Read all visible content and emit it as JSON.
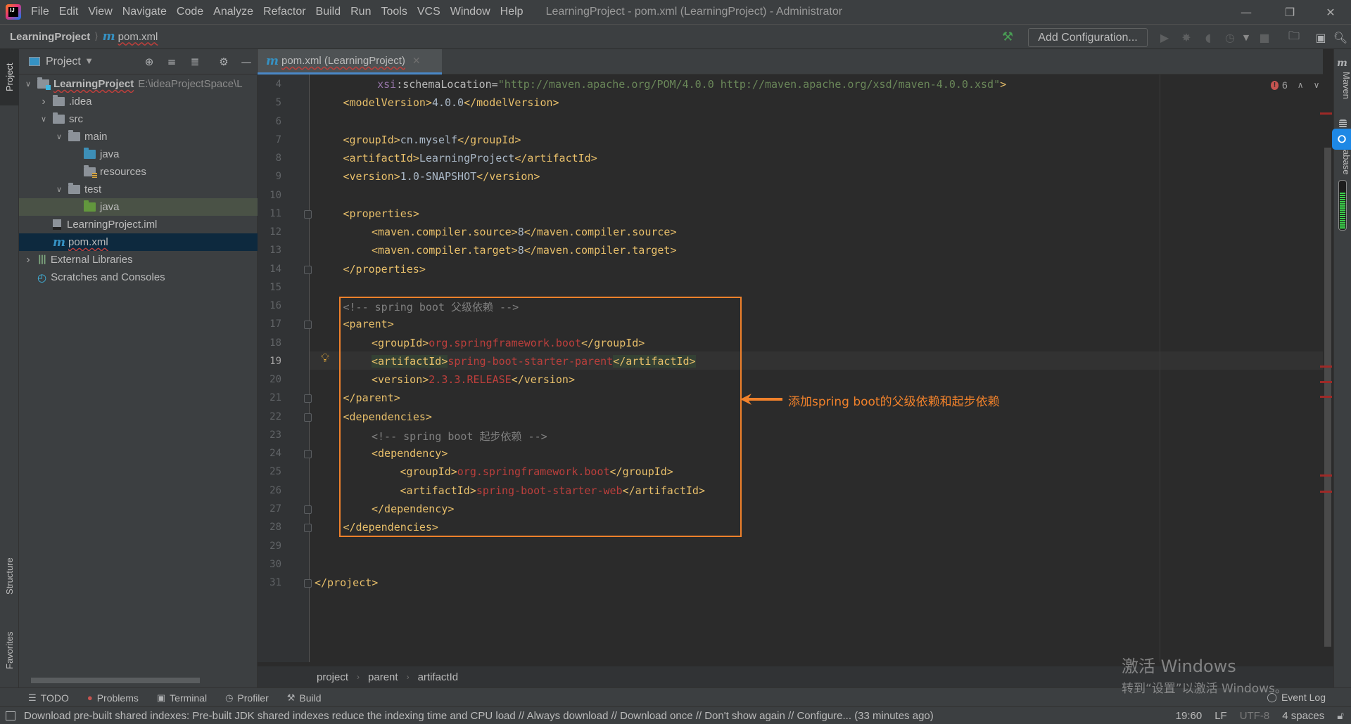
{
  "titlebar": {
    "menu": [
      "File",
      "Edit",
      "View",
      "Navigate",
      "Code",
      "Analyze",
      "Refactor",
      "Build",
      "Run",
      "Tools",
      "VCS",
      "Window",
      "Help"
    ],
    "window_title": "LearningProject - pom.xml (LearningProject) - Administrator",
    "logo_text": "IJ"
  },
  "navbar": {
    "project": "LearningProject",
    "file": "pom.xml",
    "add_configuration": "Add Configuration..."
  },
  "left_strip": {
    "project": "Project",
    "structure": "Structure",
    "favorites": "Favorites"
  },
  "project_panel": {
    "title": "Project",
    "tree": [
      {
        "label": "LearningProject",
        "path": "E:\\ideaProjectSpace\\L",
        "depth": 0,
        "expanded": true,
        "icon": "module-folder"
      },
      {
        "label": ".idea",
        "depth": 1,
        "expanded": false,
        "icon": "folder"
      },
      {
        "label": "src",
        "depth": 1,
        "expanded": true,
        "icon": "folder"
      },
      {
        "label": "main",
        "depth": 2,
        "expanded": true,
        "icon": "folder"
      },
      {
        "label": "java",
        "depth": 3,
        "icon": "source-folder"
      },
      {
        "label": "resources",
        "depth": 3,
        "icon": "resources-folder"
      },
      {
        "label": "test",
        "depth": 2,
        "expanded": true,
        "icon": "folder"
      },
      {
        "label": "java",
        "depth": 3,
        "icon": "test-folder"
      },
      {
        "label": "LearningProject.iml",
        "depth": 1,
        "icon": "iml-file"
      },
      {
        "label": "pom.xml",
        "depth": 1,
        "icon": "maven-file",
        "selected": true
      },
      {
        "label": "External Libraries",
        "depth": 0,
        "expanded": false,
        "icon": "libraries"
      },
      {
        "label": "Scratches and Consoles",
        "depth": 0,
        "icon": "scratches"
      }
    ]
  },
  "editor": {
    "tab": "pom.xml (LearningProject)",
    "error_count": "6",
    "current_line": 19,
    "lines": {
      "4": {
        "ns": "xsi",
        "attr": ":schemaLocation=",
        "val": "\"http://maven.apache.org/POM/4.0.0 http://maven.apache.org/xsd/maven-4.0.0.xsd\"",
        "close": ">"
      },
      "5": {
        "open": "<modelVersion>",
        "text": "4.0.0",
        "close": "</modelVersion>"
      },
      "7": {
        "open": "<groupId>",
        "text": "cn.myself",
        "close": "</groupId>"
      },
      "8": {
        "open": "<artifactId>",
        "text": "LearningProject",
        "close": "</artifactId>"
      },
      "9": {
        "open": "<version>",
        "text": "1.0-SNAPSHOT",
        "close": "</version>"
      },
      "11": {
        "tag": "<properties>"
      },
      "12": {
        "open": "<maven.compiler.source>",
        "text": "8",
        "close": "</maven.compiler.source>"
      },
      "13": {
        "open": "<maven.compiler.target>",
        "text": "8",
        "close": "</maven.compiler.target>"
      },
      "14": {
        "tag": "</properties>"
      },
      "16": {
        "comment": "<!-- spring boot 父级依赖 -->"
      },
      "17": {
        "tag": "<parent>"
      },
      "18": {
        "open": "<groupId>",
        "text": "org.springframework.boot",
        "close": "</groupId>"
      },
      "19": {
        "open": "<artifactId>",
        "text": "spring-boot-starter-parent",
        "close": "</artifactId>"
      },
      "20": {
        "open": "<version>",
        "text": "2.3.3.RELEASE",
        "close": "</version>"
      },
      "21": {
        "tag": "</parent>"
      },
      "22": {
        "tag": "<dependencies>"
      },
      "23": {
        "comment": "<!-- spring boot 起步依赖 -->"
      },
      "24": {
        "tag": "<dependency>"
      },
      "25": {
        "open": "<groupId>",
        "text": "org.springframework.boot",
        "close": "</groupId>"
      },
      "26": {
        "open": "<artifactId>",
        "text": "spring-boot-starter-web",
        "close": "</artifactId>"
      },
      "27": {
        "tag": "</dependency>"
      },
      "28": {
        "tag": "</dependencies>"
      },
      "31": {
        "tag": "</project>"
      }
    },
    "line_numbers": [
      "4",
      "5",
      "6",
      "7",
      "8",
      "9",
      "10",
      "11",
      "12",
      "13",
      "14",
      "15",
      "16",
      "17",
      "18",
      "19",
      "20",
      "21",
      "22",
      "23",
      "24",
      "25",
      "26",
      "27",
      "28",
      "29",
      "30",
      "31"
    ]
  },
  "annotation": {
    "text": "添加spring boot的父级依赖和起步依赖",
    "color": "#f0812b"
  },
  "right_strip": {
    "maven": "Maven",
    "database": "abase",
    "memory_usage": 0.75
  },
  "breadcrumb": [
    "project",
    "parent",
    "artifactId"
  ],
  "tool_windows": [
    {
      "label": "TODO",
      "icon": "list-icon"
    },
    {
      "label": "Problems",
      "icon": "error-icon"
    },
    {
      "label": "Terminal",
      "icon": "terminal-icon"
    },
    {
      "label": "Profiler",
      "icon": "profiler-icon"
    },
    {
      "label": "Build",
      "icon": "hammer-icon"
    }
  ],
  "event_log": "Event Log",
  "status": {
    "message": "Download pre-built shared indexes: Pre-built JDK shared indexes reduce the indexing time and CPU load // Always download // Download once // Don't show again // Configure... (33 minutes ago)",
    "position": "19:60",
    "line_sep": "LF",
    "encoding": "UTF-8",
    "indent": "4 spaces"
  },
  "watermark": {
    "line1": "激活 Windows",
    "line2": "转到“设置”以激活 Windows。"
  }
}
